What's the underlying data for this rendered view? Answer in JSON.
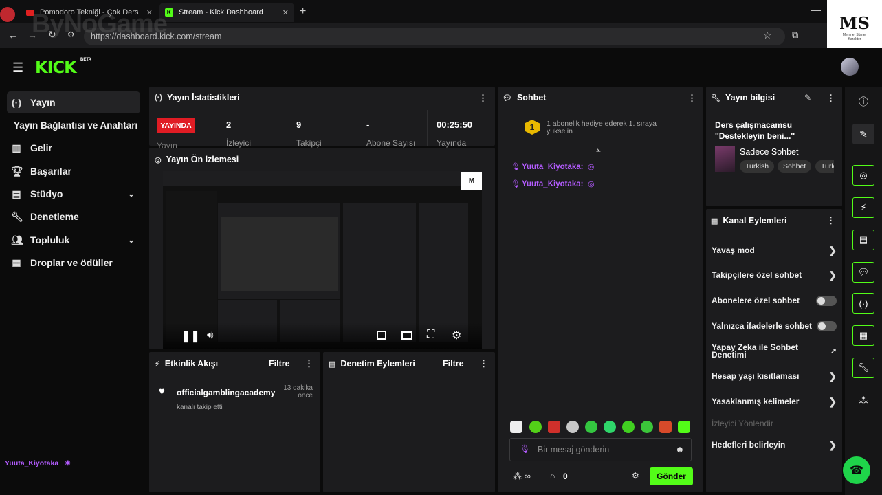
{
  "browser": {
    "tabs": [
      {
        "label": "Pomodoro Tekniği - Çok Ders",
        "active": false
      },
      {
        "label": "Stream - Kick Dashboard",
        "active": true
      }
    ],
    "url": "https://dashboard.kick.com/stream"
  },
  "watermark": {
    "text": "ByNoGame",
    "corner_logo": "MS",
    "corner_sub": "Mehmet Sümer Karakter"
  },
  "header": {
    "logo": "KICK",
    "badge": "BETA"
  },
  "sidebar": {
    "items": [
      {
        "label": "Yayın",
        "icon": "broadcast-icon",
        "active": true
      },
      {
        "label": "Yayın Bağlantısı ve Anahtarı",
        "icon": "",
        "active": false
      },
      {
        "label": "Gelir",
        "icon": "chart-icon",
        "active": false
      },
      {
        "label": "Başarılar",
        "icon": "trophy-icon",
        "active": false
      },
      {
        "label": "Stüdyo",
        "icon": "studio-icon",
        "active": false
      },
      {
        "label": "Denetleme",
        "icon": "wrench-icon",
        "active": false
      },
      {
        "label": "Topluluk",
        "icon": "users-icon",
        "active": false
      },
      {
        "label": "Droplar ve ödüller",
        "icon": "drops-icon",
        "active": false
      }
    ],
    "user": "Yuuta_Kiyotaka"
  },
  "stats": {
    "title": "Yayın İstatistikleri",
    "live_badge": "YAYINDA",
    "live_label": "Yayın",
    "items": [
      {
        "value": "2",
        "label": "İzleyici"
      },
      {
        "value": "9",
        "label": "Takipçi"
      },
      {
        "value": "-",
        "label": "Abone Sayısı"
      },
      {
        "value": "00:25:50",
        "label": "Yayında"
      }
    ]
  },
  "preview": {
    "title": "Yayın Ön İzlemesi"
  },
  "activity": {
    "title": "Etkinlik Akışı",
    "filter": "Filtre",
    "events": [
      {
        "user": "officialgamblingacademy",
        "action": "kanalı takip etti",
        "time": "13 dakika önce"
      }
    ]
  },
  "moderation": {
    "title": "Denetim Eylemleri",
    "filter": "Filtre"
  },
  "chat": {
    "title": "Sohbet",
    "pinned": "1 abonelik hediye ederek 1. sıraya yükselin",
    "pinned_rank": "1",
    "messages": [
      {
        "user": "Yuuta_Kiyotaka:",
        "color": "#b45cff"
      },
      {
        "user": "Yuuta_Kiyotaka:",
        "color": "#b45cff"
      }
    ],
    "input_placeholder": "Bir mesaj gönderin",
    "points": "0",
    "send_label": "Gönder"
  },
  "stream_info": {
    "title": "Yayın bilgisi",
    "stream_title": "Ders çalışmacamsu ''Destekleyin beni...''",
    "category": "Sadece Sohbet",
    "tags": [
      "Turkish",
      "Sohbet",
      "Turk"
    ]
  },
  "channel_actions": {
    "title": "Kanal Eylemleri",
    "items": [
      {
        "label": "Yavaş mod",
        "control": "chevron"
      },
      {
        "label": "Takipçilere özel sohbet",
        "control": "chevron"
      },
      {
        "label": "Abonelere özel sohbet",
        "control": "toggle"
      },
      {
        "label": "Yalnızca ifadelerle sohbet",
        "control": "toggle"
      },
      {
        "label": "Yapay Zeka ile Sohbet Denetimi",
        "control": "external"
      },
      {
        "label": "Hesap yaşı kısıtlaması",
        "control": "chevron"
      },
      {
        "label": "Yasaklanmış kelimeler",
        "control": "chevron"
      },
      {
        "label": "İzleyici Yönlendir",
        "control": "none",
        "disabled": true
      },
      {
        "label": "Hedefleri belirleyin",
        "control": "chevron"
      }
    ]
  },
  "colors": {
    "accent": "#53fc18",
    "live": "#e01c24",
    "username": "#b45cff"
  }
}
